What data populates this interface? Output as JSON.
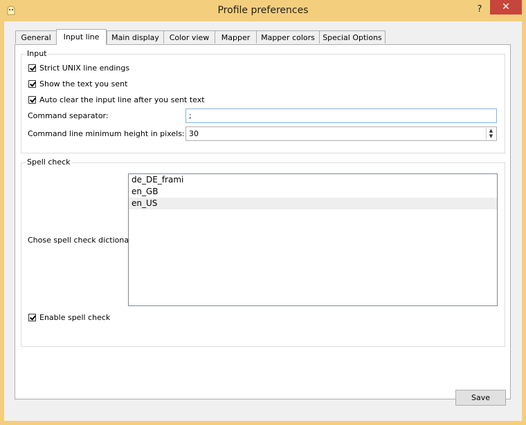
{
  "window": {
    "title": "Profile preferences",
    "help_glyph": "?",
    "close_glyph": "✕"
  },
  "tabs": [
    {
      "label": "General"
    },
    {
      "label": "Input line"
    },
    {
      "label": "Main display"
    },
    {
      "label": "Color view"
    },
    {
      "label": "Mapper"
    },
    {
      "label": "Mapper colors"
    },
    {
      "label": "Special Options"
    }
  ],
  "active_tab": "Input line",
  "input_group": {
    "title": "Input",
    "strict_unix": {
      "label": "Strict UNIX line endings",
      "checked": true
    },
    "show_text": {
      "label": "Show the text you sent",
      "checked": true
    },
    "auto_clear": {
      "label": "Auto clear the input line after you sent text",
      "checked": true
    },
    "command_separator": {
      "label": "Command separator:",
      "value": ";"
    },
    "min_height": {
      "label": "Command line minimum height in pixels:",
      "value": "30"
    }
  },
  "spell_group": {
    "title": "Spell check",
    "dict_label": "Chose spell check dictionary:",
    "dictionaries": [
      "de_DE_frami",
      "en_GB",
      "en_US"
    ],
    "selected": "en_US",
    "enable": {
      "label": "Enable spell check",
      "checked": true
    }
  },
  "footer": {
    "save_label": "Save"
  }
}
